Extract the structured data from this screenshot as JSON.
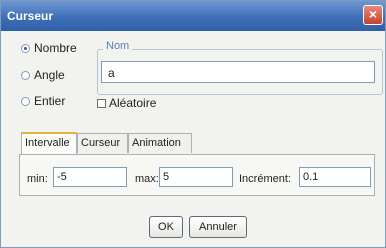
{
  "window": {
    "title": "Curseur",
    "close_label": "×"
  },
  "type_options": [
    {
      "label": "Nombre",
      "selected": true
    },
    {
      "label": "Angle",
      "selected": false
    },
    {
      "label": "Entier",
      "selected": false
    }
  ],
  "name": {
    "legend": "Nom",
    "value": "a"
  },
  "random": {
    "label": "Aléatoire",
    "checked": false
  },
  "tabs": [
    {
      "label": "Intervalle",
      "active": true
    },
    {
      "label": "Curseur",
      "active": false
    },
    {
      "label": "Animation",
      "active": false
    }
  ],
  "interval": {
    "min_label": "min:",
    "min_value": "-5",
    "max_label": "max:",
    "max_value": "5",
    "increment_label": "Incrément:",
    "increment_value": "0.1"
  },
  "buttons": {
    "ok": "OK",
    "cancel": "Annuler"
  }
}
